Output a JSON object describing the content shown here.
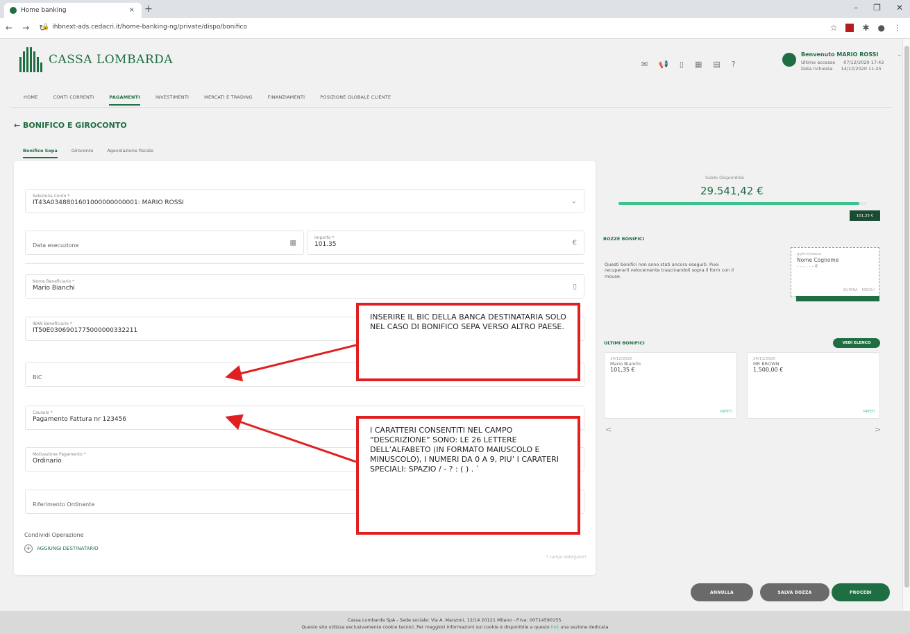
{
  "browser": {
    "tab_title": "Home banking",
    "tab_close": "×",
    "new_tab": "+",
    "url": "ihbnext-ads.cedacri.it/home-banking-ng/private/dispo/bonifico",
    "win_min": "–",
    "win_max": "❐",
    "win_close": "✕"
  },
  "header": {
    "bank_name": "CASSA LOMBARDA",
    "welcome": "Benvenuto MARIO ROSSI",
    "last_access_label": "Ultimo accesso",
    "last_access_value": "07/12/2020 17:42",
    "request_label": "Data richiesta",
    "request_value": "14/12/2020 11:25"
  },
  "nav": {
    "items": [
      "HOME",
      "CONTI CORRENTI",
      "PAGAMENTI",
      "INVESTIMENTI",
      "MERCATI E TRADING",
      "FINANZIAMENTI",
      "POSIZIONE GLOBALE CLIENTE"
    ],
    "active": "PAGAMENTI"
  },
  "page": {
    "title": "BONIFICO E GIROCONTO",
    "subtabs": [
      "Bonifico Sepa",
      "Giroconto",
      "Agevolazione fiscale"
    ]
  },
  "form": {
    "conto_label": "Seleziona Conto *",
    "conto_value": "IT43A0348801601000000000001: MARIO ROSSI",
    "data_label": "Data esecuzione",
    "importo_label": "Importo *",
    "importo_value": "101.35",
    "currency": "€",
    "nome_label": "Nome Beneficiario *",
    "nome_value": "Mario Bianchi",
    "iban_label": "IBAN Beneficiario *",
    "iban_value": "IT50E0306901775000000332211",
    "bic_label": "BIC",
    "causale_label": "Causale *",
    "causale_value": "Pagamento Fattura nr 123456",
    "motivazione_label": "Motivazione Pagamento *",
    "motivazione_value": "Ordinario",
    "riferimento_label": "Riferimento Ordinante",
    "condividi_label": "Condividi Operazione",
    "aggiungi_label": "AGGIUNGI DESTINATARIO",
    "obbligatori": "* campi obbligatori"
  },
  "right": {
    "saldo_label": "Saldo Disponibile",
    "saldo_value": "29.541,42 €",
    "bar_fill_fraction": 0.97,
    "bar_tag": "101,35 €",
    "bozze_title": "BOZZE BONIFICI",
    "bozze_text": "Questi bonifici non sono stati ancora eseguiti. Puoi recuperarli velocemente trascinandoli sopra il form con il mouse.",
    "draft_date": "gg/mm/aaaa",
    "draft_name": "Nome Cognome",
    "draft_amount": "- - - , - - €",
    "draft_delete": "ELIMINA",
    "draft_execute": "ESEGUI",
    "ultimi_title": "ULTIMI BONIFICI",
    "vedi_elenco": "VEDI ELENCO",
    "ultimi": [
      {
        "date": "14/12/2020",
        "name": "Mario Bianchi",
        "amount": "101,35 €",
        "action": "RIPETI"
      },
      {
        "date": "24/11/2020",
        "name": "MR BROWN",
        "amount": "1.500,00 €",
        "action": "RIPETI"
      }
    ],
    "prev": "<",
    "next": ">"
  },
  "annotations": {
    "bic_note": "INSERIRE IL BIC DELLA BANCA DESTINATARIA SOLO NEL CASO DI BONIFICO SEPA VERSO ALTRO PAESE.",
    "causale_note": "I CARATTERI CONSENTITI NEL CAMPO “DESCRIZIONE” SONO: LE 26 LETTERE DELL’ALFABETO (IN FORMATO MAIUSCOLO E MINUSCOLO), I NUMERI DA 0 A 9, PIU’ I CARATERI SPECIALI: SPAZIO / - ? : ( ) . `"
  },
  "buttons": {
    "annulla": "ANNULLA",
    "salva": "SALVA BOZZA",
    "procedi": "PROCEDI"
  },
  "footer": {
    "line1": "Cassa Lombarda SpA - Sede sociale: Via A. Manzoni, 12/14 20121 Milano - P.Iva: 00714590155.",
    "line2a": "Questo sito utilizza esclusivamente cookie tecnici. Per maggiori informazioni sui cookie è disponibile a questo",
    "line2_link": "link",
    "line2b": "una sezione dedicata"
  },
  "colors": {
    "brand_green": "#1f6e43",
    "accent_green": "#3cc28e",
    "annotation_red": "#e02020"
  }
}
